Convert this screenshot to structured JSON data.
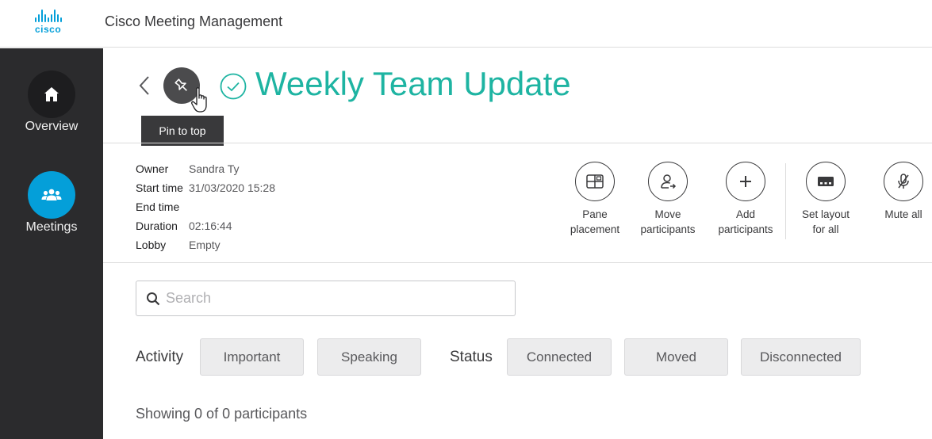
{
  "app": {
    "brand": "cisco",
    "title": "Cisco Meeting Management"
  },
  "sidebar": {
    "items": [
      {
        "label": "Overview",
        "icon": "home-icon"
      },
      {
        "label": "Meetings",
        "icon": "people-icon"
      }
    ]
  },
  "meeting": {
    "title": "Weekly Team Update",
    "status_icon": "check-circle-icon",
    "pin_tooltip": "Pin to top"
  },
  "details": {
    "rows": [
      {
        "key": "Owner",
        "value": "Sandra Ty"
      },
      {
        "key": "Start time",
        "value": "31/03/2020 15:28"
      },
      {
        "key": "End time",
        "value": ""
      },
      {
        "key": "Duration",
        "value": "02:16:44"
      },
      {
        "key": "Lobby",
        "value": "Empty"
      }
    ]
  },
  "actions": [
    {
      "line1": "Pane",
      "line2": "placement",
      "icon": "pane-placement-icon"
    },
    {
      "line1": "Move",
      "line2": "participants",
      "icon": "move-participants-icon"
    },
    {
      "line1": "Add",
      "line2": "participants",
      "icon": "add-icon"
    },
    {
      "line1": "Set layout",
      "line2": "for all",
      "icon": "layout-icon"
    },
    {
      "line1": "Mute all",
      "line2": "",
      "icon": "mute-microphone-icon"
    }
  ],
  "search": {
    "placeholder": "Search",
    "value": ""
  },
  "filters": {
    "activity_label": "Activity",
    "activity": [
      "Important",
      "Speaking"
    ],
    "status_label": "Status",
    "status": [
      "Connected",
      "Moved",
      "Disconnected"
    ]
  },
  "participants": {
    "summary": "Showing 0 of 0 participants"
  },
  "colors": {
    "brand": "#049fd9",
    "title": "#1eb4a2",
    "sidebar": "#2b2b2d"
  }
}
